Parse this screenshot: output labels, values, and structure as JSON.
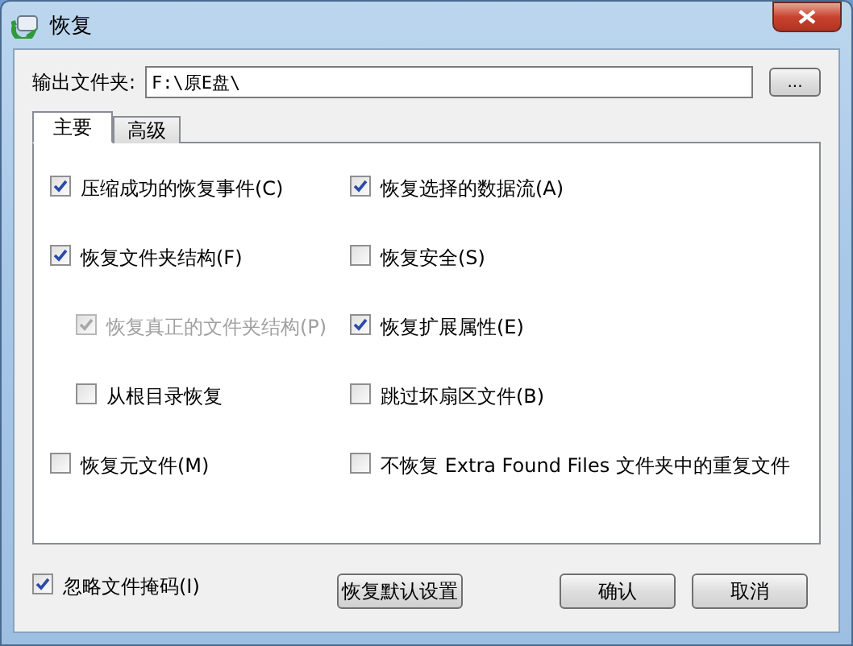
{
  "window": {
    "title": "恢复"
  },
  "output_folder": {
    "label": "输出文件夹:",
    "value": "F:\\原E盘\\",
    "browse_button": "..."
  },
  "tabs": [
    {
      "label": "主要",
      "selected": true
    },
    {
      "label": "高级",
      "selected": false
    }
  ],
  "left_options": [
    {
      "label": "压缩成功的恢复事件(C)",
      "checked": true,
      "disabled": false
    },
    {
      "label": "恢复文件夹结构(F)",
      "checked": true,
      "disabled": false,
      "children": [
        {
          "label": "恢复真正的文件夹结构(P)",
          "checked": true,
          "disabled": true
        },
        {
          "label": "从根目录恢复",
          "checked": false,
          "disabled": false
        }
      ]
    },
    {
      "label": "恢复元文件(M)",
      "checked": false,
      "disabled": false
    }
  ],
  "right_options": [
    {
      "label": "恢复选择的数据流(A)",
      "checked": true,
      "disabled": false
    },
    {
      "label": "恢复安全(S)",
      "checked": false,
      "disabled": false
    },
    {
      "label": "恢复扩展属性(E)",
      "checked": true,
      "disabled": false
    },
    {
      "label": "跳过坏扇区文件(B)",
      "checked": false,
      "disabled": false
    },
    {
      "label": "不恢复 Extra Found Files 文件夹中的重复文件",
      "checked": false,
      "disabled": false
    }
  ],
  "ignore_mask": {
    "label": "忽略文件掩码(I)",
    "checked": true,
    "disabled": false
  },
  "buttons": [
    {
      "label": "恢复默认设置",
      "kind": "defaults"
    },
    {
      "label": "确认",
      "kind": "ok"
    },
    {
      "label": "取消",
      "kind": "cancel"
    }
  ]
}
